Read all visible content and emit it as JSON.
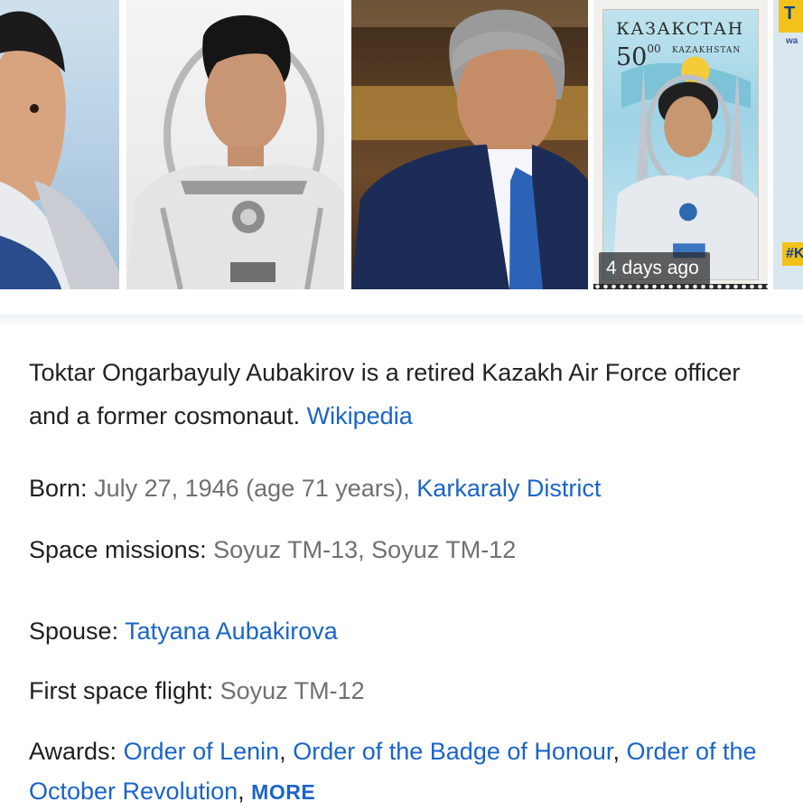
{
  "images": {
    "stamp": {
      "country": "КАЗАКСТАН",
      "value": "50",
      "value_fraction": "00",
      "latin": "KAZAKHSTAN"
    },
    "time_badge": "4 days ago",
    "partial_badge": "T",
    "partial_small": "wa",
    "partial_tag": "#K"
  },
  "summary": {
    "text": "Toktar Ongarbayuly Aubakirov is a retired Kazakh Air Force officer and a former cosmonaut.",
    "source_link": "Wikipedia"
  },
  "facts": {
    "born": {
      "label": "Born:",
      "value": "July 27, 1946 (age 71 years),",
      "link": "Karkaraly District"
    },
    "space_missions": {
      "label": "Space missions:",
      "value": "Soyuz TM-13, Soyuz TM-12"
    },
    "spouse": {
      "label": "Spouse:",
      "link": "Tatyana Aubakirova"
    },
    "first_flight": {
      "label": "First space flight:",
      "value": "Soyuz TM-12"
    },
    "awards": {
      "label": "Awards:",
      "links": [
        "Order of Lenin",
        "Order of the Badge of Honour",
        "Order of the October Revolution"
      ],
      "separator": ",",
      "more": "MORE"
    }
  },
  "colors": {
    "link": "#1a64c8",
    "label": "#1f1f1f",
    "value": "#707070"
  }
}
